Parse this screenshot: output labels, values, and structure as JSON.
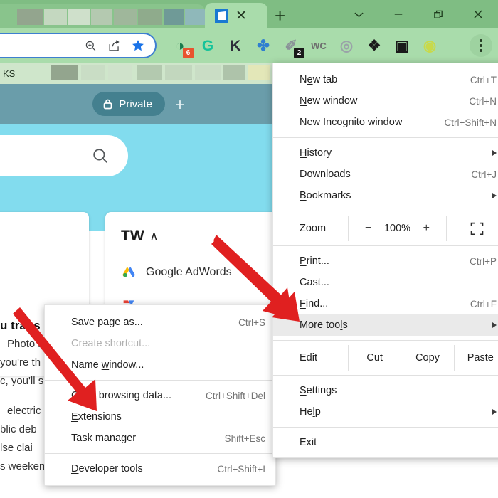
{
  "window": {
    "tab_close_label": "✕",
    "new_tab_label": "+",
    "controls": [
      "tab-search",
      "minimize",
      "restore",
      "close"
    ]
  },
  "toolbar": {
    "extensions": [
      {
        "name": "adblock-extension",
        "glyph": "◑",
        "badge": "6",
        "badge_color": "#e8532e",
        "color": "#1a7a4c"
      },
      {
        "name": "grammarly-extension",
        "glyph": "G",
        "badge": "",
        "badge_color": "",
        "color": "#15c39a"
      },
      {
        "name": "kaspersky-extension",
        "glyph": "K",
        "badge": "",
        "badge_color": "",
        "color": "#2d2d3a"
      },
      {
        "name": "honey-extension",
        "glyph": "✤",
        "badge": "",
        "badge_color": "",
        "color": "#2f7fd0"
      },
      {
        "name": "clipboard-extension",
        "glyph": "✐",
        "badge": "2",
        "badge_color": "#1a1a1a",
        "color": "#8a9298"
      },
      {
        "name": "wordcount-extension",
        "glyph": "WC",
        "badge": "",
        "badge_color": "",
        "color": "#6e6e6e"
      },
      {
        "name": "screenshot-extension",
        "glyph": "◎",
        "badge": "",
        "badge_color": "",
        "color": "#9aa2a8"
      },
      {
        "name": "puzzle-extensions-icon",
        "glyph": "❖",
        "badge": "",
        "badge_color": "",
        "color": "#1a1a1a"
      },
      {
        "name": "sidepanel-icon",
        "glyph": "▣",
        "badge": "",
        "badge_color": "",
        "color": "#1a1a1a"
      },
      {
        "name": "profile-avatar",
        "glyph": "◉",
        "badge": "",
        "badge_color": "",
        "color": "#c8d94a"
      }
    ],
    "omnibox_icons": [
      "zoom-icon",
      "share-icon",
      "bookmark-star-icon"
    ]
  },
  "bookmarks_bar": {
    "first_label": "KS"
  },
  "page": {
    "private_label": "Private",
    "hero_plus": "+",
    "card_title": "TW",
    "card_chevron": "∧",
    "adwords_label": "Google AdWords",
    "article": {
      "heading": "u trans",
      "lines": [
        "Photo b",
        "you're th",
        "c, you'll s"
      ],
      "lines2": [
        "electric",
        "blic deb",
        "lse clai",
        "s weekend"
      ]
    }
  },
  "main_menu": {
    "items": [
      {
        "label": "New tab",
        "u": 1,
        "accel": "Ctrl+T",
        "arrow": false,
        "name": "menu-item-new-tab"
      },
      {
        "label": "New window",
        "u": 0,
        "accel": "Ctrl+N",
        "arrow": false,
        "name": "menu-item-new-window"
      },
      {
        "label": "New Incognito window",
        "u": 4,
        "accel": "Ctrl+Shift+N",
        "arrow": false,
        "name": "menu-item-new-incognito-window"
      }
    ],
    "items2": [
      {
        "label": "History",
        "u": 0,
        "accel": "",
        "arrow": true,
        "name": "menu-item-history"
      },
      {
        "label": "Downloads",
        "u": 0,
        "accel": "Ctrl+J",
        "arrow": false,
        "name": "menu-item-downloads"
      },
      {
        "label": "Bookmarks",
        "u": 0,
        "accel": "",
        "arrow": true,
        "name": "menu-item-bookmarks"
      }
    ],
    "zoom": {
      "label": "Zoom",
      "minus": "−",
      "value": "100%",
      "plus": "+",
      "fullscreen_icon": "fullscreen-icon"
    },
    "items3": [
      {
        "label": "Print...",
        "u": 0,
        "accel": "Ctrl+P",
        "arrow": false,
        "name": "menu-item-print"
      },
      {
        "label": "Cast...",
        "u": 0,
        "accel": "",
        "arrow": false,
        "name": "menu-item-cast"
      },
      {
        "label": "Find...",
        "u": 0,
        "accel": "Ctrl+F",
        "arrow": false,
        "name": "menu-item-find"
      }
    ],
    "more_tools": {
      "label": "More tools",
      "u": 8,
      "accel": "",
      "arrow": true,
      "highlighted": true
    },
    "edit_row": {
      "label": "Edit",
      "actions": [
        "Cut",
        "Copy",
        "Paste"
      ]
    },
    "items4": [
      {
        "label": "Settings",
        "u": 0,
        "accel": "",
        "arrow": false,
        "name": "menu-item-settings"
      },
      {
        "label": "Help",
        "u": 2,
        "accel": "",
        "arrow": true,
        "name": "menu-item-help"
      }
    ],
    "items5": [
      {
        "label": "Exit",
        "u": 1,
        "accel": "",
        "arrow": false,
        "name": "menu-item-exit"
      }
    ]
  },
  "sub_menu": {
    "items": [
      {
        "label": "Save page as...",
        "u": 10,
        "accel": "Ctrl+S",
        "disabled": false,
        "name": "submenu-item-save-page-as"
      },
      {
        "label": "Create shortcut...",
        "u": -1,
        "accel": "",
        "disabled": true,
        "name": "submenu-item-create-shortcut"
      },
      {
        "label": "Name window...",
        "u": 5,
        "accel": "",
        "disabled": false,
        "name": "submenu-item-name-window"
      }
    ],
    "items2": [
      {
        "label": "Clear browsing data...",
        "u": 0,
        "accel": "Ctrl+Shift+Del",
        "disabled": false,
        "name": "submenu-item-clear-browsing-data"
      },
      {
        "label": "Extensions",
        "u": 0,
        "accel": "",
        "disabled": false,
        "name": "submenu-item-extensions"
      },
      {
        "label": "Task manager",
        "u": 0,
        "accel": "Shift+Esc",
        "disabled": false,
        "name": "submenu-item-task-manager"
      }
    ],
    "items3": [
      {
        "label": "Developer tools",
        "u": 0,
        "accel": "Ctrl+Shift+I",
        "disabled": false,
        "name": "submenu-item-developer-tools"
      }
    ]
  },
  "annotations": {
    "arrow_color": "#e02020",
    "arrow1_target": "More tools",
    "arrow2_target": "Extensions"
  }
}
